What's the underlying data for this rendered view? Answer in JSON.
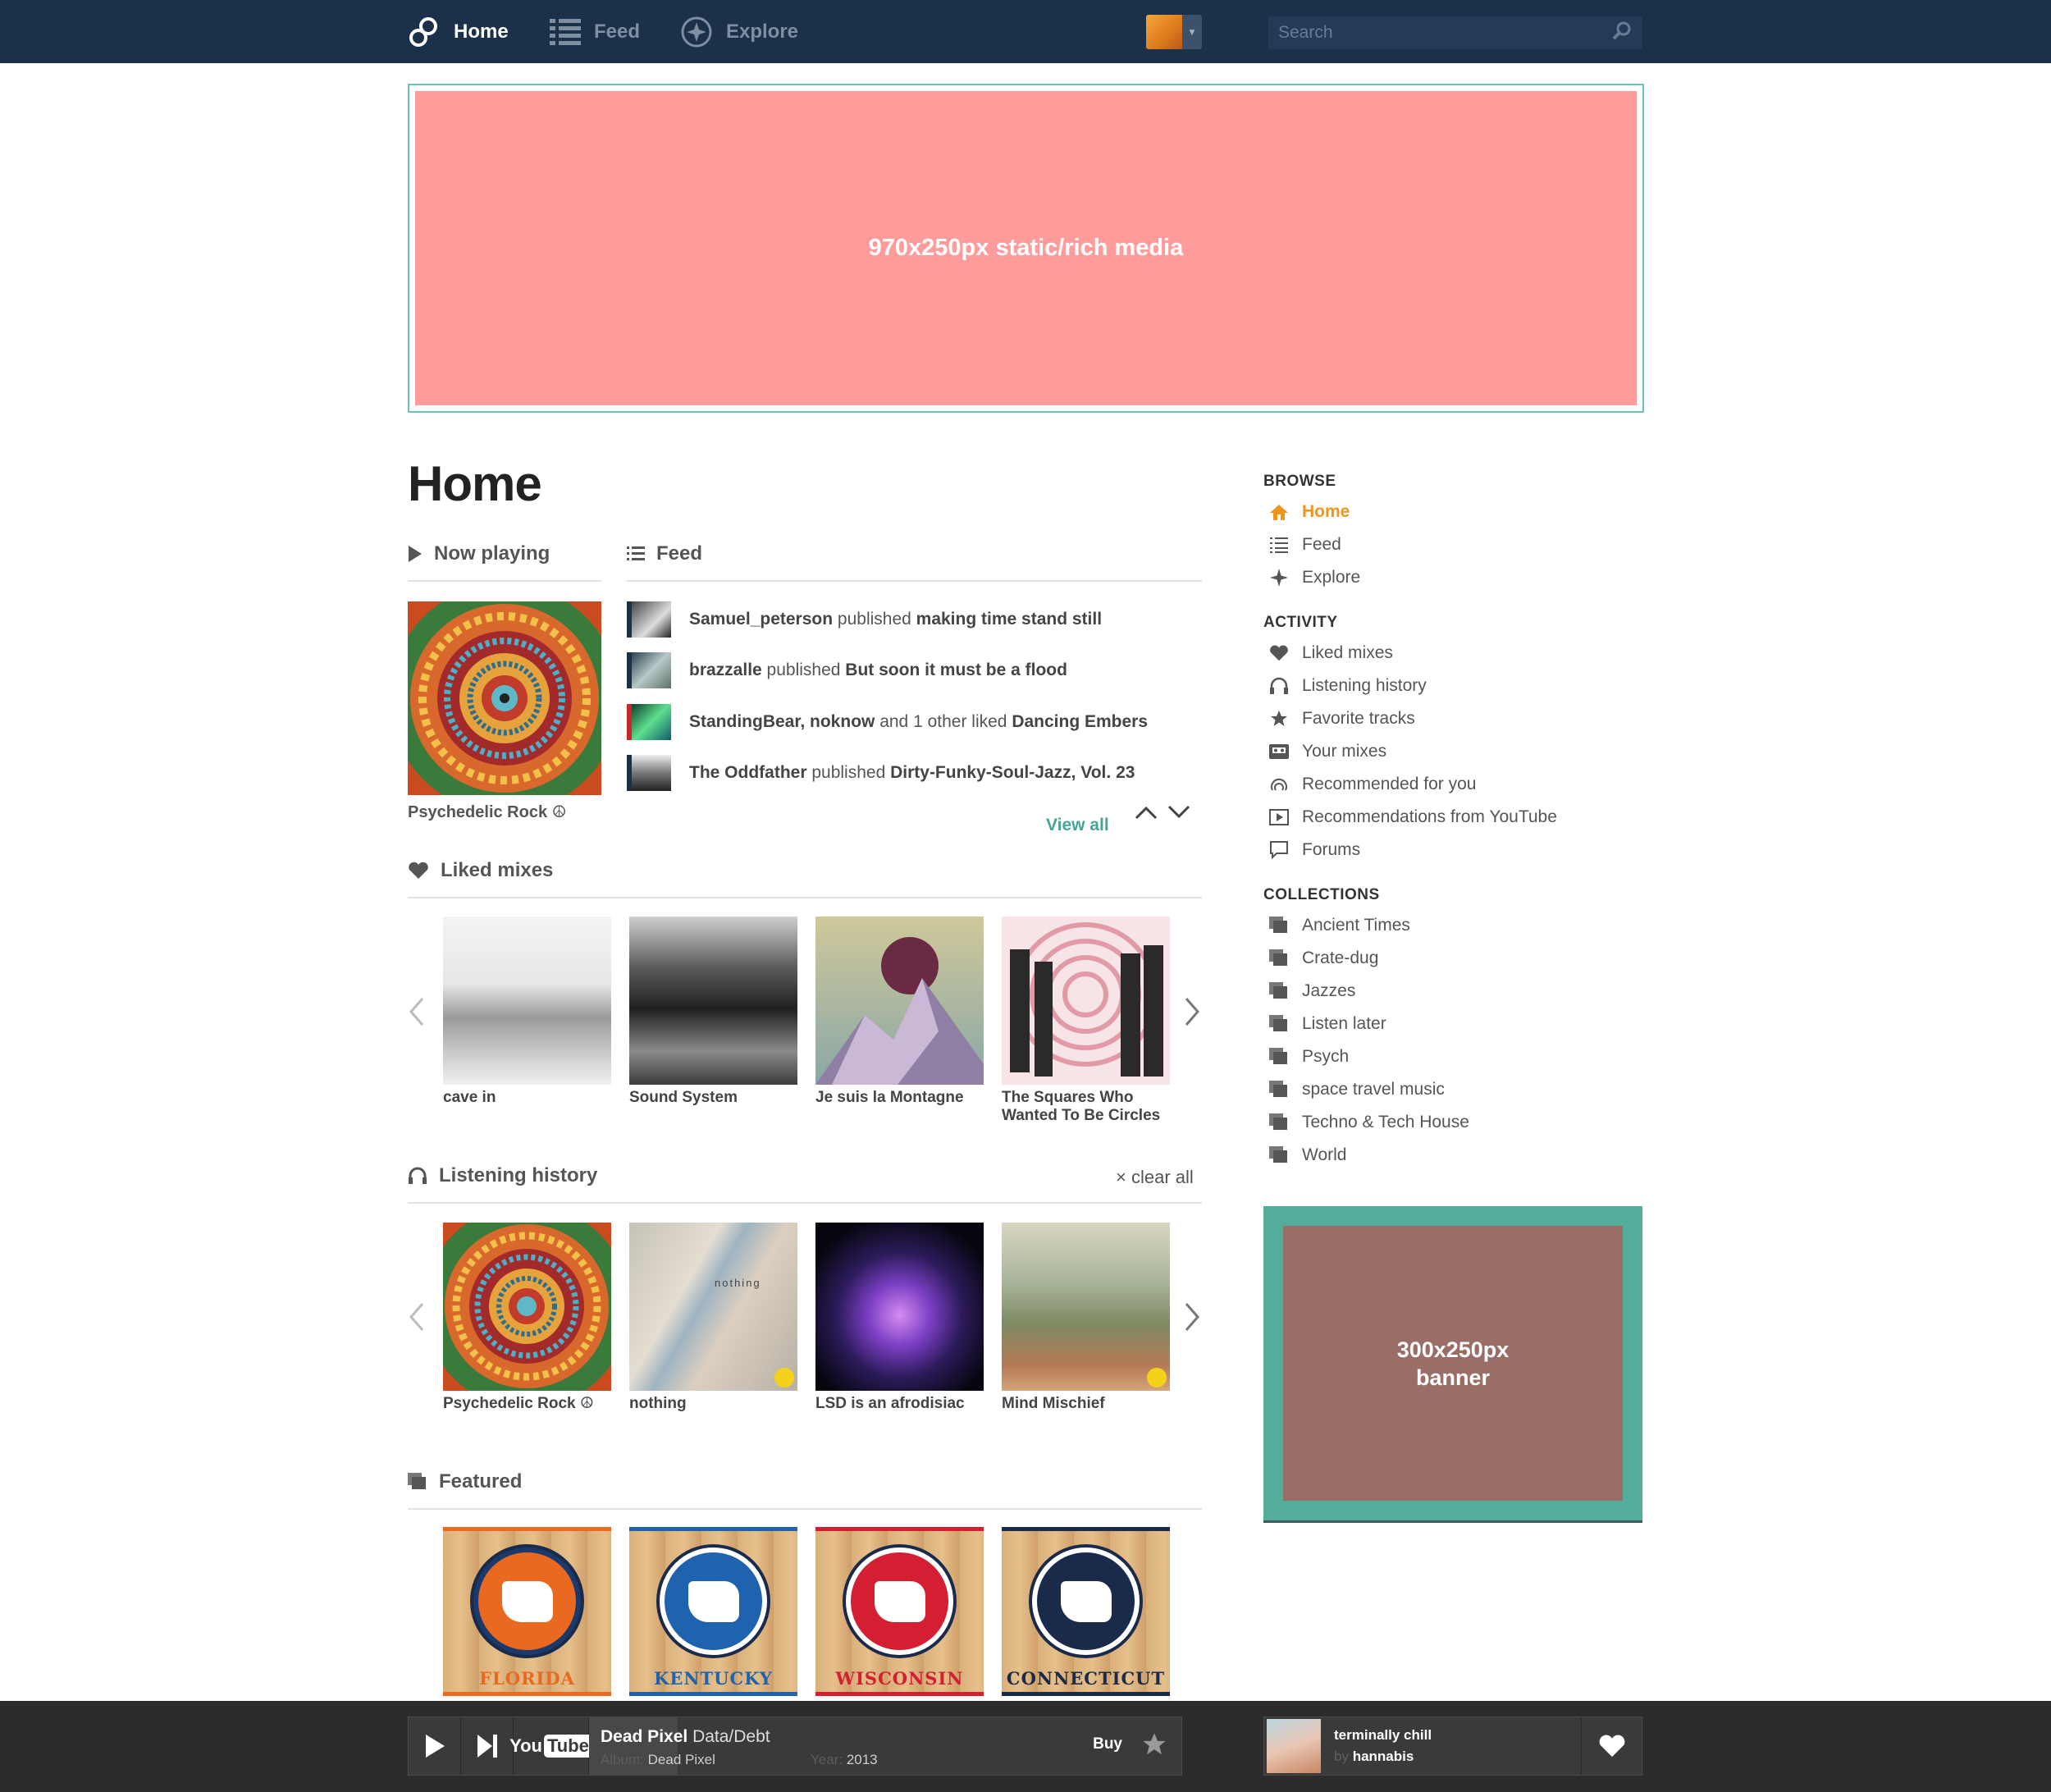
{
  "nav": {
    "home": "Home",
    "feed": "Feed",
    "explore": "Explore",
    "search_placeholder": "Search"
  },
  "ads": {
    "top": "970x250px static/rich media",
    "side_line1": "300x250px",
    "side_line2": "banner"
  },
  "page": {
    "title": "Home"
  },
  "now_playing": {
    "heading": "Now playing",
    "caption": "Psychedelic Rock ☮"
  },
  "feed": {
    "heading": "Feed",
    "items": [
      {
        "actor": "Samuel_peterson",
        "verb": " published ",
        "object": "making time stand still"
      },
      {
        "actor": "brazzalle",
        "verb": " published ",
        "object": "But soon it must be a flood"
      },
      {
        "actor": "StandingBear, noknow",
        "verb": " and 1 other liked ",
        "object": "Dancing Embers"
      },
      {
        "actor": "The Oddfather",
        "verb": " published ",
        "object": "Dirty-Funky-Soul-Jazz, Vol. 23"
      }
    ],
    "view_all": "View all"
  },
  "liked_mixes": {
    "heading": "Liked mixes",
    "items": [
      {
        "title": "cave in"
      },
      {
        "title": "Sound System"
      },
      {
        "title": "Je suis la Montagne"
      },
      {
        "title": "The Squares Who Wanted To Be Circles"
      }
    ]
  },
  "listening_history": {
    "heading": "Listening history",
    "clear_all": "clear all",
    "items": [
      {
        "title": "Psychedelic Rock ☮"
      },
      {
        "title": "nothing",
        "art_text": "nothing"
      },
      {
        "title": "LSD is an afrodisiac"
      },
      {
        "title": "Mind Mischief"
      }
    ]
  },
  "featured": {
    "heading": "Featured",
    "items": [
      {
        "state": "FLORIDA",
        "color": "#e8691f",
        "ring": "#1b3a6b"
      },
      {
        "state": "KENTUCKY",
        "color": "#1f62ad",
        "ring": "#ffffff"
      },
      {
        "state": "WISCONSIN",
        "color": "#d41f33",
        "ring": "#ffffff"
      },
      {
        "state": "CONNECTICUT",
        "color": "#1a2a4a",
        "ring": "#ffffff"
      }
    ]
  },
  "sidebar": {
    "browse": {
      "heading": "BROWSE",
      "items": [
        {
          "label": "Home",
          "icon": "home-icon"
        },
        {
          "label": "Feed",
          "icon": "list-icon"
        },
        {
          "label": "Explore",
          "icon": "compass-star-icon"
        }
      ]
    },
    "activity": {
      "heading": "ACTIVITY",
      "items": [
        {
          "label": "Liked mixes",
          "icon": "heart-icon"
        },
        {
          "label": "Listening history",
          "icon": "headphones-icon"
        },
        {
          "label": "Favorite tracks",
          "icon": "star-icon"
        },
        {
          "label": "Your mixes",
          "icon": "cassette-icon"
        },
        {
          "label": "Recommended for you",
          "icon": "recommend-icon"
        },
        {
          "label": "Recommendations from YouTube",
          "icon": "youtube-play-icon"
        },
        {
          "label": "Forums",
          "icon": "speech-bubble-icon"
        }
      ]
    },
    "collections": {
      "heading": "COLLECTIONS",
      "items": [
        {
          "label": "Ancient Times"
        },
        {
          "label": "Crate-dug"
        },
        {
          "label": "Jazzes"
        },
        {
          "label": "Listen later"
        },
        {
          "label": "Psych"
        },
        {
          "label": "space travel music"
        },
        {
          "label": "Techno & Tech House"
        },
        {
          "label": "World"
        }
      ]
    }
  },
  "player": {
    "track_title": "Dead Pixel",
    "artist": "Data/Debt",
    "album_label": "Album:",
    "album": "Dead Pixel",
    "year_label": "Year:",
    "year": "2013",
    "buy": "Buy",
    "youtube_you": "You",
    "youtube_tube": "Tube",
    "progress": 0.15,
    "mix_title": "terminally chill",
    "mix_by_label": "by",
    "mix_by": "hannabis"
  },
  "colors": {
    "nav_bg": "#1b3049",
    "accent_orange": "#f0941c",
    "accent_teal": "#46a597",
    "ad_top_bg": "#fe9c9c",
    "ad_side_frame": "#54ad9a",
    "ad_side_bg": "#9a6e66",
    "player_bg": "#2c2c2c"
  }
}
